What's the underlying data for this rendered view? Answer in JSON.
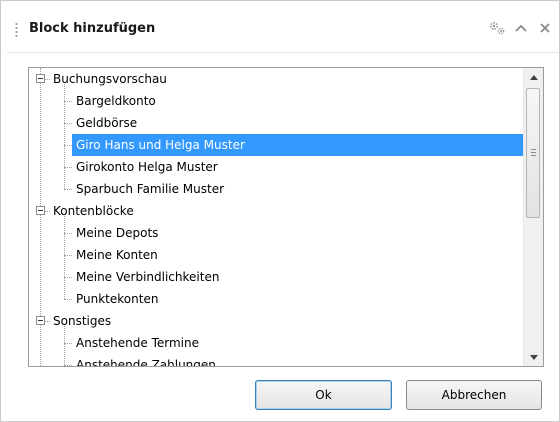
{
  "title": "Block hinzufügen",
  "icons": [
    "settings-gears-icon",
    "chevron-up-icon",
    "close-icon"
  ],
  "tree": {
    "groups": [
      {
        "label": "Buchungsvorschau",
        "expanded": true,
        "items": [
          "Bargeldkonto",
          "Geldbörse",
          "Giro Hans und Helga Muster",
          "Girokonto Helga Muster",
          "Sparbuch Familie Muster"
        ]
      },
      {
        "label": "Kontenblöcke",
        "expanded": true,
        "items": [
          "Meine Depots",
          "Meine Konten",
          "Meine Verbindlichkeiten",
          "Punktekonten"
        ]
      },
      {
        "label": "Sonstiges",
        "expanded": true,
        "items": [
          "Anstehende Termine",
          "Anstehende Zahlungen"
        ]
      }
    ],
    "selected": "Giro Hans und Helga Muster"
  },
  "buttons": {
    "ok": "Ok",
    "cancel": "Abbrechen"
  },
  "colors": {
    "selection": "#3399ff",
    "default_button_border": "#3c7fb1"
  }
}
